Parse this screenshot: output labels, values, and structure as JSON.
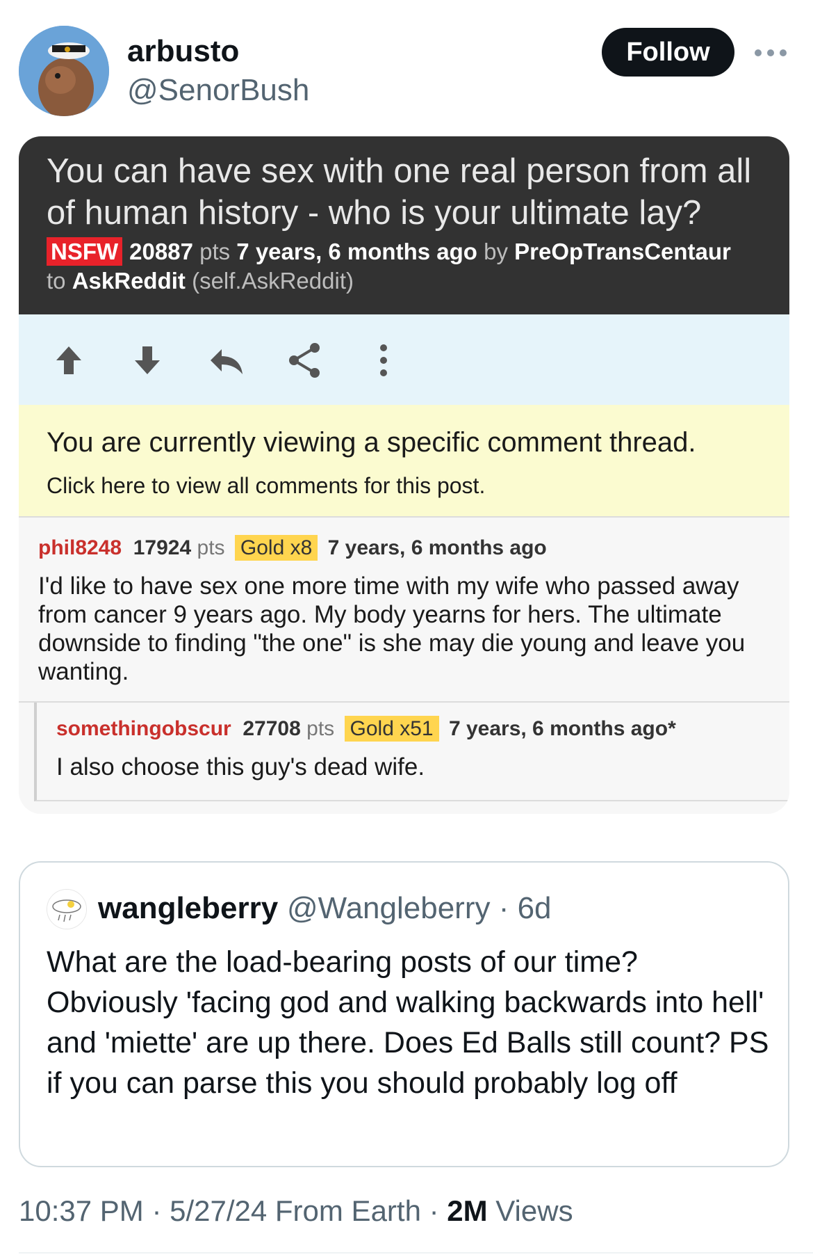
{
  "author": {
    "name": "arbusto",
    "handle": "@SenorBush",
    "follow_label": "Follow"
  },
  "reddit": {
    "title": "You can have sex with one real person from all of human history - who is your ultimate lay?",
    "nsfw": "NSFW",
    "points": "20887",
    "pts_label": "pts",
    "age": "7 years, 6 months ago",
    "by_label": "by",
    "poster": "PreOpTransCentaur",
    "to_label": "to",
    "subreddit": "AskReddit",
    "subreddit_note": "(self.AskReddit)",
    "notice_main": "You are currently viewing a specific comment thread.",
    "notice_sub": "Click here to view all comments for this post.",
    "comments": [
      {
        "user": "phil8248",
        "points": "17924",
        "pts_label": "pts",
        "gold": "Gold x8",
        "age": "7 years, 6 months ago",
        "body": "I'd like to have sex one more time with my wife who passed away from cancer 9 years ago. My body yearns for hers. The ultimate downside to finding \"the one\" is she may die young and leave you wanting."
      },
      {
        "user": "somethingobscur",
        "points": "27708",
        "pts_label": "pts",
        "gold": "Gold x51",
        "age": "7 years, 6 months ago*",
        "body": "I also choose this guy's dead wife."
      }
    ]
  },
  "quote": {
    "name": "wangleberry",
    "handle_time": "@Wangleberry · 6d",
    "text": "What are the load-bearing posts of our time? Obviously 'facing god and walking backwards into hell' and 'miette' are up there. Does Ed Balls still count? PS if you can parse this you should probably log off"
  },
  "footer": {
    "timestamp": "10:37 PM · 5/27/24 From Earth · ",
    "views_count": "2M",
    "views_label": " Views"
  },
  "icons": [
    "avatar",
    "more-dots-icon",
    "upvote-arrow-icon",
    "downvote-arrow-icon",
    "reply-icon",
    "share-icon",
    "vertical-dots-icon",
    "cloud-avatar"
  ],
  "colors": {
    "follow_bg": "#0f1419",
    "nsfw": "#e8222a",
    "gold": "#ffd54f",
    "reddit_header": "#323232",
    "username": "#c9302c"
  }
}
